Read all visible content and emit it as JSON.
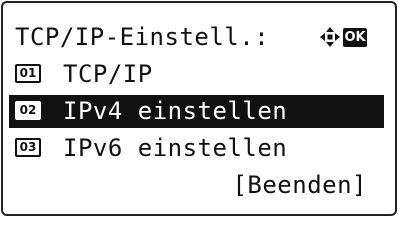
{
  "title": "TCP/IP-Einstell.:",
  "icons": {
    "nav": "four-way-arrow-icon",
    "ok": "OK"
  },
  "items": [
    {
      "number": "01",
      "label": "TCP/IP",
      "selected": false
    },
    {
      "number": "02",
      "label": "IPv4 einstellen",
      "selected": true
    },
    {
      "number": "03",
      "label": "IPv6 einstellen",
      "selected": false
    }
  ],
  "end_label": "[Beenden]",
  "colors": {
    "background": "#ffffff",
    "foreground": "#111111",
    "highlight": "#111111"
  }
}
